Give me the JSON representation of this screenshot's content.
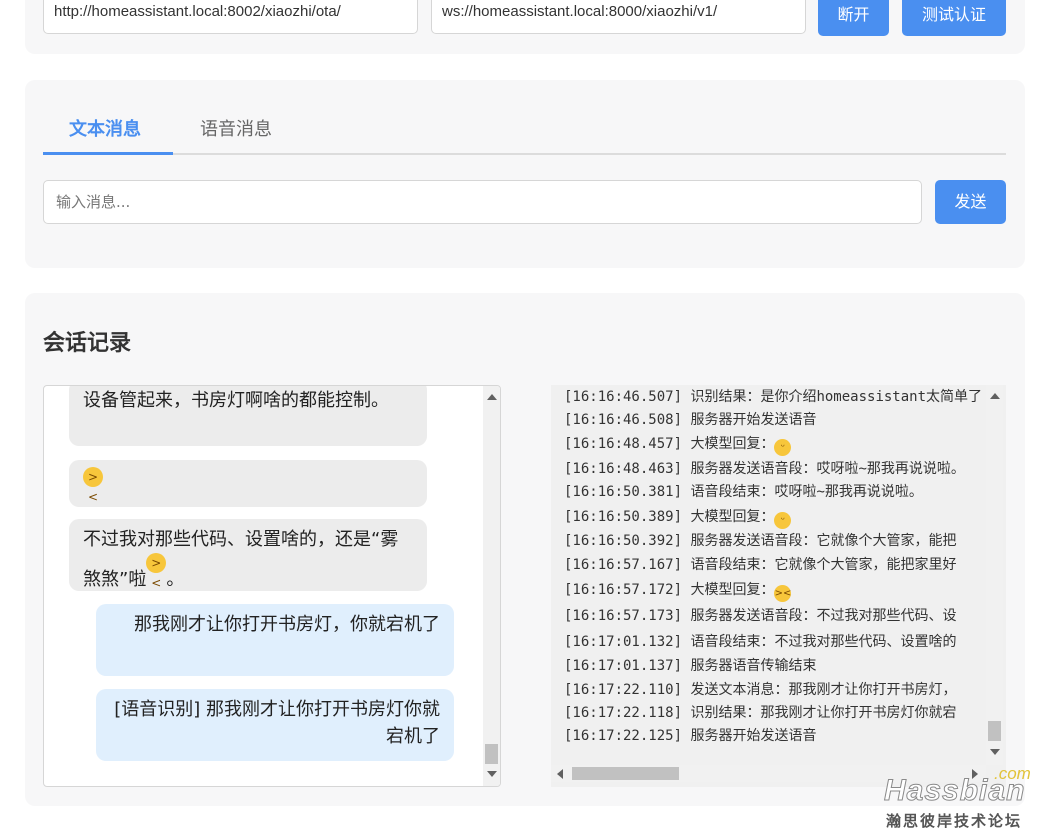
{
  "connection": {
    "ota_url": "http://homeassistant.local:8002/xiaozhi/ota/",
    "ws_url": "ws://homeassistant.local:8000/xiaozhi/v1/",
    "disconnect_label": "断开",
    "test_auth_label": "测试认证"
  },
  "message": {
    "tabs": [
      {
        "label": "文本消息",
        "active": true
      },
      {
        "label": "语音消息",
        "active": false
      }
    ],
    "input_placeholder": "输入消息...",
    "send_label": "发送"
  },
  "conversation": {
    "title": "会话记录",
    "bubbles": [
      {
        "role": "bot",
        "text": "设备管起来，书房灯啊啥的都能控制。"
      },
      {
        "role": "bot",
        "text": "",
        "emoji": "laughing-emoji"
      },
      {
        "role": "bot",
        "text": "不过我对那些代码、设置啥的，还是“雾煞煞”啦",
        "emoji": "laughing-emoji",
        "suffix": "。"
      },
      {
        "role": "user",
        "text": "那我刚才让你打开书房灯，你就宕机了"
      },
      {
        "role": "user",
        "text": "[语音识别] 那我刚才让你打开书房灯你就宕机了"
      }
    ]
  },
  "debug_log": [
    {
      "time": "[16:16:46.507]",
      "text": "识别结果：是你介绍homeassistant太简单了"
    },
    {
      "time": "[16:16:46.508]",
      "text": "服务器开始发送语音"
    },
    {
      "time": "[16:16:48.457]",
      "text": "大模型回复：",
      "emoji": "smile-emoji"
    },
    {
      "time": "[16:16:48.463]",
      "text": "服务器发送语音段：哎呀啦~那我再说说啦。"
    },
    {
      "time": "[16:16:50.381]",
      "text": "语音段结束：哎呀啦~那我再说说啦。"
    },
    {
      "time": "[16:16:50.389]",
      "text": "大模型回复：",
      "emoji": "smile-emoji"
    },
    {
      "time": "[16:16:50.392]",
      "text": "服务器发送语音段：它就像个大管家，能把"
    },
    {
      "time": "[16:16:57.167]",
      "text": "语音段结束：它就像个大管家，能把家里好"
    },
    {
      "time": "[16:16:57.172]",
      "text": "大模型回复：",
      "emoji": "laughing-emoji"
    },
    {
      "time": "[16:16:57.173]",
      "text": "服务器发送语音段：不过我对那些代码、设"
    },
    {
      "time": "[16:17:01.132]",
      "text": "语音段结束：不过我对那些代码、设置啥的"
    },
    {
      "time": "[16:17:01.137]",
      "text": "服务器语音传输结束"
    },
    {
      "time": "[16:17:22.110]",
      "text": "发送文本消息：那我刚才让你打开书房灯，"
    },
    {
      "time": "[16:17:22.118]",
      "text": "识别结果：那我刚才让你打开书房灯你就宕"
    },
    {
      "time": "[16:17:22.125]",
      "text": "服务器开始发送语音"
    }
  ],
  "watermark": {
    "brand": "Hassbian",
    "tld": ".com",
    "subtitle": "瀚思彼岸技术论坛"
  },
  "colors": {
    "accent": "#4a8ff0",
    "card_bg": "#f7f7f8",
    "bot_bubble": "#ececec",
    "user_bubble": "#e0effd"
  }
}
